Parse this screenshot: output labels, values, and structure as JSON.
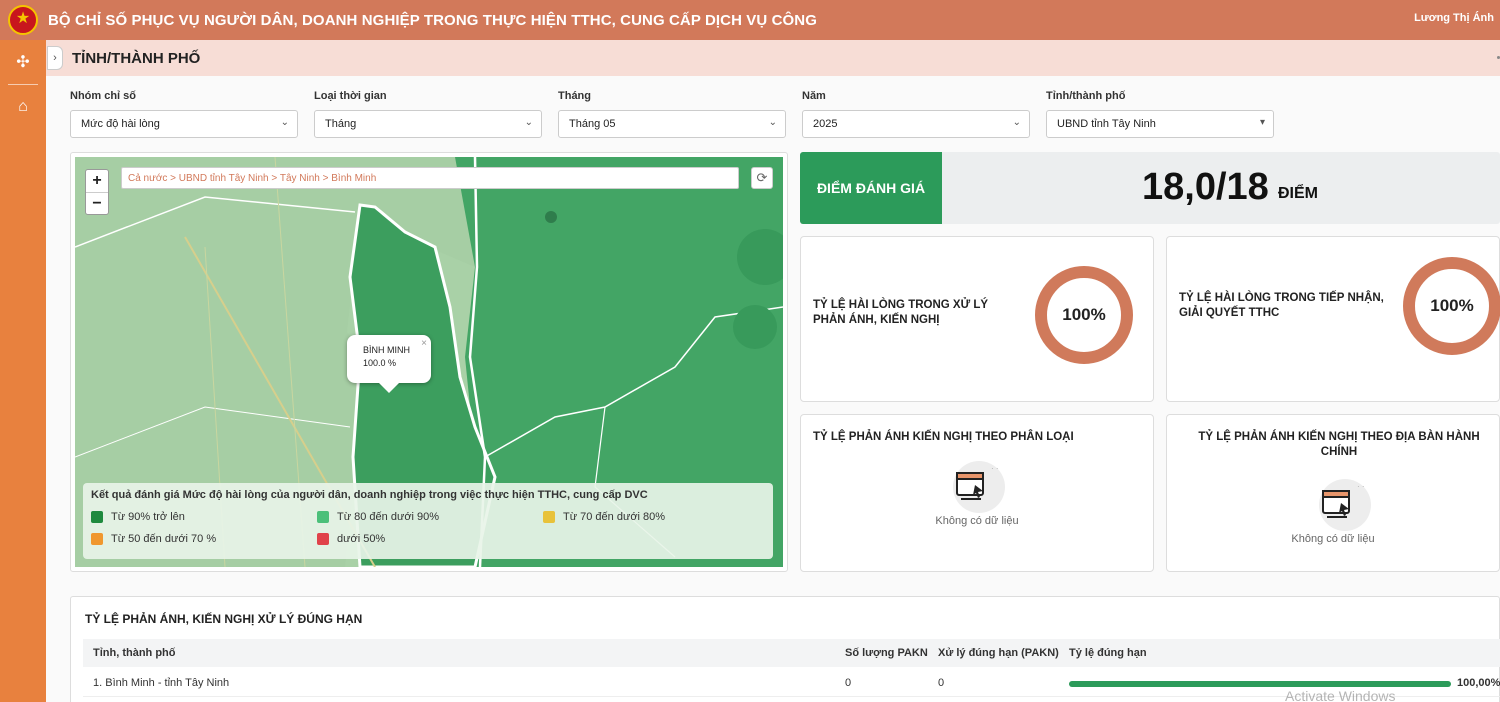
{
  "header": {
    "title": "BỘ CHỈ SỐ PHỤC VỤ NGƯỜI DÂN, DOANH NGHIỆP TRONG THỰC HIỆN TTHC, CUNG CẤP DỊCH VỤ CÔNG",
    "user": "Lương Thị Ánh"
  },
  "sidebar": {
    "items": [
      {
        "icon": "sitemap-icon",
        "glyph": "✣"
      },
      {
        "icon": "home-icon",
        "glyph": "⌂"
      }
    ],
    "expand_glyph": "›"
  },
  "page": {
    "title": "TỈNH/THÀNH PHỐ"
  },
  "filters": [
    {
      "label": "Nhóm chỉ số",
      "value": "Mức độ hài lòng"
    },
    {
      "label": "Loại thời gian",
      "value": "Tháng"
    },
    {
      "label": "Tháng",
      "value": "Tháng 05"
    },
    {
      "label": "Năm",
      "value": "2025"
    },
    {
      "label": "Tỉnh/thành phố",
      "value": "UBND tỉnh Tây Ninh"
    }
  ],
  "map": {
    "zoom_in": "+",
    "zoom_out": "−",
    "breadcrumb": "Cả nước > UBND tỉnh Tây Ninh > Tây Ninh > Bình Minh",
    "refresh_glyph": "⟳",
    "popup": {
      "name": "BÌNH MINH",
      "value": "100.0 %",
      "close": "×"
    },
    "legend": {
      "title": "Kết quả đánh giá Mức độ hài lòng của người dân, doanh nghiệp trong việc thực hiện TTHC, cung cấp DVC",
      "items": [
        {
          "label": "Từ 90% trở lên",
          "color": "#1e8a3e"
        },
        {
          "label": "Từ 80 đến dưới 90%",
          "color": "#4cc07a"
        },
        {
          "label": "Từ 70 đến dưới 80%",
          "color": "#e8c23a"
        },
        {
          "label": "Từ 50 đến dưới 70 %",
          "color": "#f0972e"
        },
        {
          "label": "dưới 50%",
          "color": "#e0424a"
        }
      ]
    }
  },
  "score": {
    "label": "ĐIỂM ĐÁNH GIÁ",
    "value": "18,0/18",
    "unit": "ĐIỂM"
  },
  "cards": {
    "complaint_handling": {
      "title": "TỶ LỆ HÀI LÒNG TRONG XỬ LÝ PHẢN ÁNH, KIẾN NGHỊ",
      "value": "100%"
    },
    "tthc_handling": {
      "title": "TỶ LỆ HÀI LÒNG TRONG TIẾP NHẬN, GIẢI QUYẾT TTHC",
      "value": "100%"
    },
    "by_category": {
      "title": "TỶ LỆ PHẢN ÁNH KIẾN NGHỊ THEO PHÂN LOẠI",
      "empty": "Không có dữ liệu"
    },
    "by_area": {
      "title": "TỶ LỆ PHẢN ÁNH KIẾN NGHỊ THEO ĐỊA BÀN HÀNH CHÍNH",
      "empty": "Không có dữ liệu"
    }
  },
  "table": {
    "title": "TỶ LỆ PHẢN ÁNH, KIẾN NGHỊ XỬ LÝ ĐÚNG HẠN",
    "columns": [
      "Tỉnh, thành phố",
      "Số lượng PAKN",
      "Xử lý đúng hạn (PAKN)",
      "Tỷ lệ đúng hạn"
    ],
    "rows": [
      {
        "name": "1. Bình Minh - tỉnh Tây Ninh",
        "count": "0",
        "ontime": "0",
        "rate": "100,00%",
        "rate_fraction": 1.0
      }
    ]
  },
  "watermark": "Activate Windows",
  "colors": {
    "header": "#d2795a",
    "rail": "#e8813e",
    "accent_green": "#2c9b5a",
    "donut": "#d07a5b"
  }
}
